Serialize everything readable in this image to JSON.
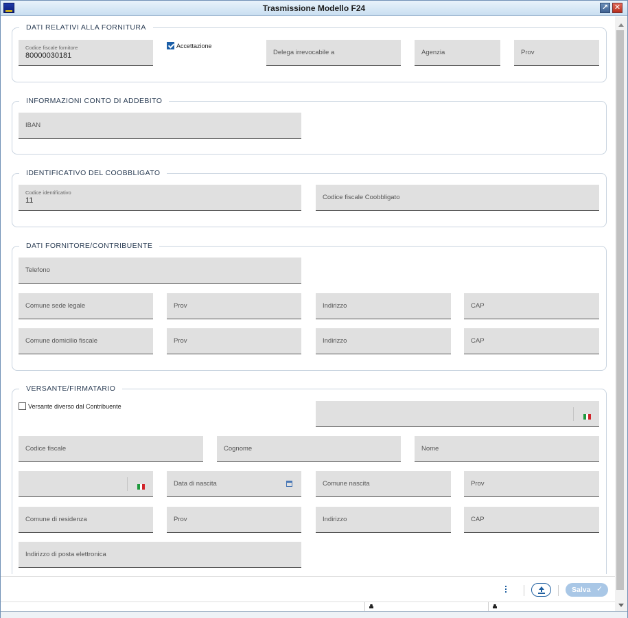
{
  "window": {
    "title": "Trasmissione Modello F24"
  },
  "fornitura": {
    "legend": "DATI RELATIVI ALLA FORNITURA",
    "codice_fiscale_label": "Codice fiscale fornitore",
    "codice_fiscale_value": "80000030181",
    "accettazione_label": "Accettazione",
    "accettazione_checked": true,
    "delega_label": "Delega irrevocabile a",
    "agenzia_label": "Agenzia",
    "prov_label": "Prov"
  },
  "conto": {
    "legend": "INFORMAZIONI CONTO DI ADDEBITO",
    "iban_label": "IBAN"
  },
  "coobbligato": {
    "legend": "IDENTIFICATIVO DEL COOBBLIGATO",
    "codice_id_label": "Codice identificativo",
    "codice_id_value": "11",
    "cf_coobbligato_label": "Codice fiscale Coobbligato"
  },
  "contribuente": {
    "legend": "DATI FORNITORE/CONTRIBUENTE",
    "telefono_label": "Telefono",
    "comune_sede_label": "Comune sede legale",
    "prov_label": "Prov",
    "indirizzo_label": "Indirizzo",
    "cap_label": "CAP",
    "comune_domicilio_label": "Comune domicilio fiscale"
  },
  "versante": {
    "legend": "VERSANTE/FIRMATARIO",
    "diverso_label": "Versante diverso dal Contribuente",
    "diverso_checked": false,
    "codice_fiscale_label": "Codice fiscale",
    "cognome_label": "Cognome",
    "nome_label": "Nome",
    "data_nascita_label": "Data di nascita",
    "comune_nascita_label": "Comune nascita",
    "prov_label": "Prov",
    "comune_residenza_label": "Comune di residenza",
    "indirizzo_label": "Indirizzo",
    "cap_label": "CAP",
    "email_label": "Indirizzo di posta elettronica"
  },
  "footer": {
    "save_label": "Salva",
    "save_icon": "check-icon",
    "more_icon": "kebab-icon",
    "upload_icon": "upload-icon"
  },
  "colors": {
    "accent": "#1f5fa0",
    "field_bg": "#e0e0e0",
    "save_disabled": "#a9c7e6",
    "flag_green": "#1f9a3e",
    "flag_red": "#d2232a"
  }
}
